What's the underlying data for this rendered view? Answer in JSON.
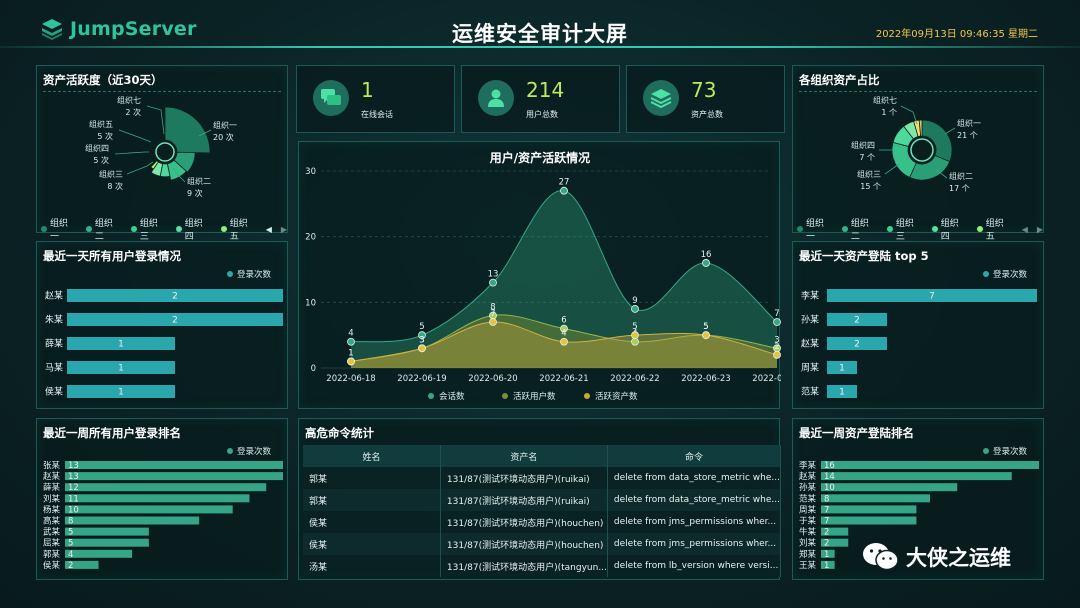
{
  "header": {
    "logo_text": "JumpServer",
    "title": "运维安全审计大屏",
    "datetime": "2022年09月13日 09:46:35 星期二"
  },
  "colors": {
    "accent": "#30c49a",
    "bar_teal": "#2aa7ad",
    "bar_green": "#36a587",
    "series_session": "#35a882",
    "series_user": "#7c8f34",
    "series_asset": "#c9a836"
  },
  "asset_activity": {
    "title": "资产活跃度（近30天）",
    "legend": [
      "组织一",
      "组织二",
      "组织三",
      "组织四",
      "组织五"
    ],
    "legend_colors": [
      "#1f8a6a",
      "#2bb58a",
      "#3fd08f",
      "#54e2a0",
      "#8ff07a"
    ],
    "labels": [
      {
        "name": "组织七",
        "value": "2 次"
      },
      {
        "name": "组织五",
        "value": "5 次"
      },
      {
        "name": "组织四",
        "value": "5 次"
      },
      {
        "name": "组织三",
        "value": "8 次"
      },
      {
        "name": "组织一",
        "value": "20 次"
      },
      {
        "name": "组织二",
        "value": "9 次"
      }
    ],
    "slices": [
      {
        "name": "组织一",
        "value": 20,
        "color": "#1d7a5f"
      },
      {
        "name": "组织二",
        "value": 9,
        "color": "#2a9e77"
      },
      {
        "name": "组织三",
        "value": 8,
        "color": "#38c08b"
      },
      {
        "name": "组织四",
        "value": 5,
        "color": "#4fd89c"
      },
      {
        "name": "组织五",
        "value": 5,
        "color": "#7de6a8"
      },
      {
        "name": "组织七",
        "value": 2,
        "color": "#b8ee6a"
      }
    ]
  },
  "org_assets": {
    "title": "各组织资产占比",
    "legend": [
      "组织一",
      "组织二",
      "组织三",
      "组织四",
      "组织五"
    ],
    "legend_colors": [
      "#1f8a6a",
      "#2bb58a",
      "#3fd08f",
      "#54e2a0",
      "#8ff07a"
    ],
    "labels": [
      {
        "name": "组织七",
        "value": "1 个"
      },
      {
        "name": "组织四",
        "value": "7 个"
      },
      {
        "name": "组织三",
        "value": "15 个"
      },
      {
        "name": "组织一",
        "value": "21 个"
      },
      {
        "name": "组织二",
        "value": "17 个"
      }
    ],
    "slices": [
      {
        "name": "组织一",
        "value": 21,
        "color": "#1d7a5f"
      },
      {
        "name": "组织二",
        "value": 17,
        "color": "#2a9e77"
      },
      {
        "name": "组织三",
        "value": 15,
        "color": "#38c08b"
      },
      {
        "name": "组织四",
        "value": 7,
        "color": "#4fd89c"
      },
      {
        "name": "组织五",
        "value": 4,
        "color": "#7de6a8"
      },
      {
        "name": "组织六",
        "value": 2,
        "color": "#e8e06a"
      },
      {
        "name": "组织七",
        "value": 1,
        "color": "#f2c94c"
      }
    ]
  },
  "stats": [
    {
      "value": "1",
      "label": "在线会话"
    },
    {
      "value": "214",
      "label": "用户总数"
    },
    {
      "value": "73",
      "label": "资产总数"
    }
  ],
  "user_login_day": {
    "title": "最近一天所有用户登录情况",
    "legend": "登录次数",
    "max": 2,
    "rows": [
      {
        "name": "赵某",
        "value": 2
      },
      {
        "name": "朱某",
        "value": 2
      },
      {
        "name": "薛某",
        "value": 1
      },
      {
        "name": "马某",
        "value": 1
      },
      {
        "name": "侯某",
        "value": 1
      }
    ]
  },
  "asset_login_day": {
    "title": "最近一天资产登陆 top 5",
    "legend": "登录次数",
    "max": 7,
    "rows": [
      {
        "name": "李某",
        "value": 7
      },
      {
        "name": "孙某",
        "value": 2
      },
      {
        "name": "赵某",
        "value": 2
      },
      {
        "name": "周某",
        "value": 1
      },
      {
        "name": "范某",
        "value": 1
      }
    ]
  },
  "user_login_week": {
    "title": "最近一周所有用户登录排名",
    "legend": "登录次数",
    "max": 13,
    "rows": [
      {
        "name": "张某",
        "value": 13
      },
      {
        "name": "赵某",
        "value": 13
      },
      {
        "name": "薛某",
        "value": 12
      },
      {
        "name": "刘某",
        "value": 11
      },
      {
        "name": "杨某",
        "value": 10
      },
      {
        "name": "高某",
        "value": 8
      },
      {
        "name": "武某",
        "value": 5
      },
      {
        "name": "屈某",
        "value": 5
      },
      {
        "name": "郭某",
        "value": 4
      },
      {
        "name": "侯某",
        "value": 2
      }
    ]
  },
  "asset_login_week": {
    "title": "最近一周资产登陆排名",
    "legend": "登录次数",
    "max": 16,
    "rows": [
      {
        "name": "李某",
        "value": 16
      },
      {
        "name": "赵某",
        "value": 14
      },
      {
        "name": "孙某",
        "value": 10
      },
      {
        "name": "范某",
        "value": 8
      },
      {
        "name": "周某",
        "value": 7
      },
      {
        "name": "于某",
        "value": 7
      },
      {
        "name": "牛某",
        "value": 2
      },
      {
        "name": "刘某",
        "value": 2
      },
      {
        "name": "郑某",
        "value": 1
      },
      {
        "name": "王某",
        "value": 1
      }
    ]
  },
  "commands": {
    "title": "高危命令统计",
    "columns": [
      "姓名",
      "资产名",
      "命令"
    ],
    "rows": [
      [
        "郭某",
        "131/87(测试环境动态用户)(ruikai)",
        "delete from data_store_metric whe..."
      ],
      [
        "郭某",
        "131/87(测试环境动态用户)(ruikai)",
        "delete from data_store_metric whe..."
      ],
      [
        "侯某",
        "131/87(测试环境动态用户)(houchen)",
        "delete from jms_permissions wher..."
      ],
      [
        "侯某",
        "131/87(测试环境动态用户)(houchen)",
        "delete from jms_permissions wher..."
      ],
      [
        "汤某",
        "131/87(测试环境动态用户)(tangyun...",
        "delete from lb_version where versi..."
      ]
    ]
  },
  "chart_data": {
    "type": "area",
    "title": "用户/资产活跃情况",
    "categories": [
      "2022-06-18",
      "2022-06-19",
      "2022-06-20",
      "2022-06-21",
      "2022-06-22",
      "2022-06-23",
      "2022-06-24"
    ],
    "ylim": [
      0,
      30
    ],
    "yticks": [
      0,
      10,
      20,
      30
    ],
    "series": [
      {
        "name": "会话数",
        "values": [
          4,
          5,
          13,
          27,
          9,
          16,
          7
        ]
      },
      {
        "name": "活跃用户数",
        "values": [
          1,
          3,
          8,
          6,
          4,
          5,
          3
        ]
      },
      {
        "name": "活跃资产数",
        "values": [
          1,
          3,
          7,
          4,
          5,
          5,
          2
        ]
      }
    ]
  },
  "watermark": {
    "text": "大侠之运维"
  }
}
